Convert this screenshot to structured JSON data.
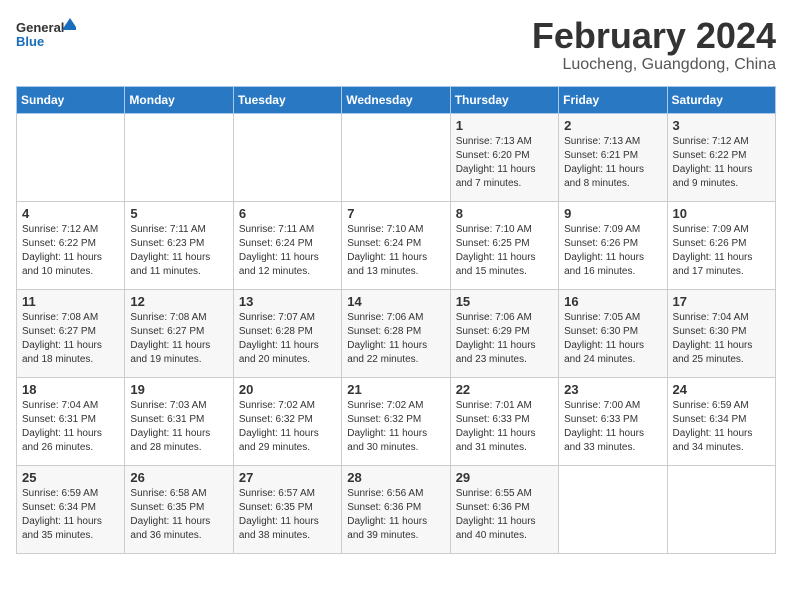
{
  "header": {
    "logo_line1": "General",
    "logo_line2": "Blue",
    "title": "February 2024",
    "subtitle": "Luocheng, Guangdong, China"
  },
  "days_of_week": [
    "Sunday",
    "Monday",
    "Tuesday",
    "Wednesday",
    "Thursday",
    "Friday",
    "Saturday"
  ],
  "weeks": [
    [
      null,
      null,
      null,
      null,
      {
        "day": "1",
        "sunrise": "7:13 AM",
        "sunset": "6:20 PM",
        "daylight": "11 hours and 7 minutes."
      },
      {
        "day": "2",
        "sunrise": "7:13 AM",
        "sunset": "6:21 PM",
        "daylight": "11 hours and 8 minutes."
      },
      {
        "day": "3",
        "sunrise": "7:12 AM",
        "sunset": "6:22 PM",
        "daylight": "11 hours and 9 minutes."
      }
    ],
    [
      {
        "day": "4",
        "sunrise": "7:12 AM",
        "sunset": "6:22 PM",
        "daylight": "11 hours and 10 minutes."
      },
      {
        "day": "5",
        "sunrise": "7:11 AM",
        "sunset": "6:23 PM",
        "daylight": "11 hours and 11 minutes."
      },
      {
        "day": "6",
        "sunrise": "7:11 AM",
        "sunset": "6:24 PM",
        "daylight": "11 hours and 12 minutes."
      },
      {
        "day": "7",
        "sunrise": "7:10 AM",
        "sunset": "6:24 PM",
        "daylight": "11 hours and 13 minutes."
      },
      {
        "day": "8",
        "sunrise": "7:10 AM",
        "sunset": "6:25 PM",
        "daylight": "11 hours and 15 minutes."
      },
      {
        "day": "9",
        "sunrise": "7:09 AM",
        "sunset": "6:26 PM",
        "daylight": "11 hours and 16 minutes."
      },
      {
        "day": "10",
        "sunrise": "7:09 AM",
        "sunset": "6:26 PM",
        "daylight": "11 hours and 17 minutes."
      }
    ],
    [
      {
        "day": "11",
        "sunrise": "7:08 AM",
        "sunset": "6:27 PM",
        "daylight": "11 hours and 18 minutes."
      },
      {
        "day": "12",
        "sunrise": "7:08 AM",
        "sunset": "6:27 PM",
        "daylight": "11 hours and 19 minutes."
      },
      {
        "day": "13",
        "sunrise": "7:07 AM",
        "sunset": "6:28 PM",
        "daylight": "11 hours and 20 minutes."
      },
      {
        "day": "14",
        "sunrise": "7:06 AM",
        "sunset": "6:28 PM",
        "daylight": "11 hours and 22 minutes."
      },
      {
        "day": "15",
        "sunrise": "7:06 AM",
        "sunset": "6:29 PM",
        "daylight": "11 hours and 23 minutes."
      },
      {
        "day": "16",
        "sunrise": "7:05 AM",
        "sunset": "6:30 PM",
        "daylight": "11 hours and 24 minutes."
      },
      {
        "day": "17",
        "sunrise": "7:04 AM",
        "sunset": "6:30 PM",
        "daylight": "11 hours and 25 minutes."
      }
    ],
    [
      {
        "day": "18",
        "sunrise": "7:04 AM",
        "sunset": "6:31 PM",
        "daylight": "11 hours and 26 minutes."
      },
      {
        "day": "19",
        "sunrise": "7:03 AM",
        "sunset": "6:31 PM",
        "daylight": "11 hours and 28 minutes."
      },
      {
        "day": "20",
        "sunrise": "7:02 AM",
        "sunset": "6:32 PM",
        "daylight": "11 hours and 29 minutes."
      },
      {
        "day": "21",
        "sunrise": "7:02 AM",
        "sunset": "6:32 PM",
        "daylight": "11 hours and 30 minutes."
      },
      {
        "day": "22",
        "sunrise": "7:01 AM",
        "sunset": "6:33 PM",
        "daylight": "11 hours and 31 minutes."
      },
      {
        "day": "23",
        "sunrise": "7:00 AM",
        "sunset": "6:33 PM",
        "daylight": "11 hours and 33 minutes."
      },
      {
        "day": "24",
        "sunrise": "6:59 AM",
        "sunset": "6:34 PM",
        "daylight": "11 hours and 34 minutes."
      }
    ],
    [
      {
        "day": "25",
        "sunrise": "6:59 AM",
        "sunset": "6:34 PM",
        "daylight": "11 hours and 35 minutes."
      },
      {
        "day": "26",
        "sunrise": "6:58 AM",
        "sunset": "6:35 PM",
        "daylight": "11 hours and 36 minutes."
      },
      {
        "day": "27",
        "sunrise": "6:57 AM",
        "sunset": "6:35 PM",
        "daylight": "11 hours and 38 minutes."
      },
      {
        "day": "28",
        "sunrise": "6:56 AM",
        "sunset": "6:36 PM",
        "daylight": "11 hours and 39 minutes."
      },
      {
        "day": "29",
        "sunrise": "6:55 AM",
        "sunset": "6:36 PM",
        "daylight": "11 hours and 40 minutes."
      },
      null,
      null
    ]
  ]
}
